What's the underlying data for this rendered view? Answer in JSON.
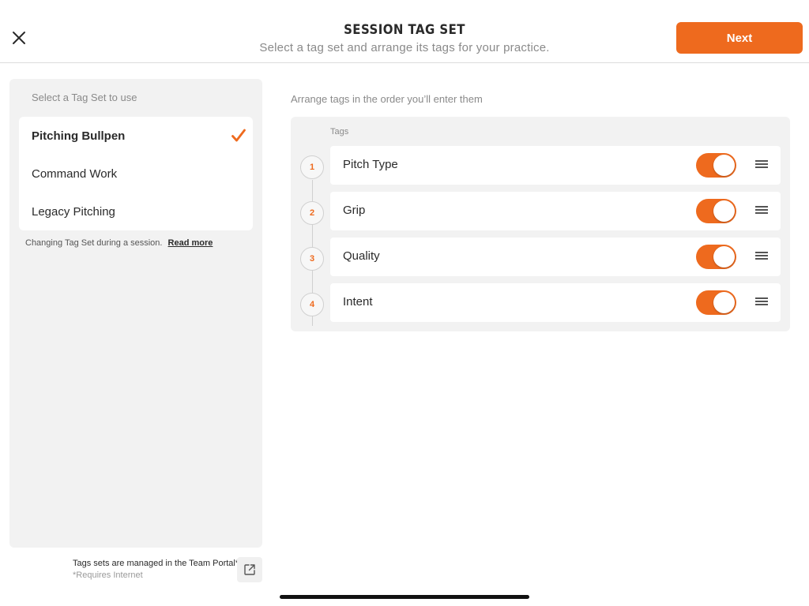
{
  "header": {
    "title": "SESSION TAG SET",
    "subtitle": "Select a tag set and arrange its tags for your practice.",
    "next_label": "Next",
    "close_icon": "close-icon"
  },
  "left": {
    "label": "Select a Tag Set to use",
    "tagsets": [
      {
        "label": "Pitching Bullpen",
        "selected": true
      },
      {
        "label": "Command Work",
        "selected": false
      },
      {
        "label": "Legacy Pitching",
        "selected": false
      }
    ],
    "note": "Changing Tag Set during a session.",
    "read_more": "Read more",
    "portal_note": "Tags sets are managed in the Team Portal*",
    "requires": "*Requires Internet"
  },
  "right": {
    "arrange_label": "Arrange tags in the order you’ll enter them",
    "tags_label": "Tags",
    "tags": [
      {
        "number": "1",
        "name": "Pitch Type",
        "enabled": true
      },
      {
        "number": "2",
        "name": "Grip",
        "enabled": true
      },
      {
        "number": "3",
        "name": "Quality",
        "enabled": true
      },
      {
        "number": "4",
        "name": "Intent",
        "enabled": true
      }
    ]
  },
  "colors": {
    "accent": "#ee6a1e",
    "panel": "#f2f2f2",
    "text": "#2a2a2a",
    "muted": "#8a8a8a"
  }
}
